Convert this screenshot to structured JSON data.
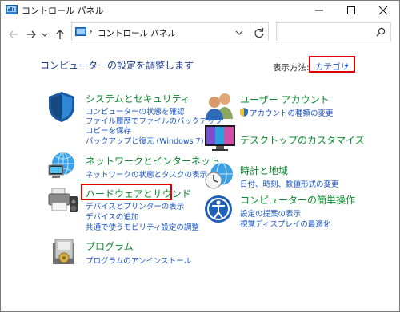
{
  "window": {
    "title": "コントロール パネル"
  },
  "address": {
    "crumb": "コントロール パネル",
    "search_placeholder": ""
  },
  "header": {
    "page_title": "コンピューターの設定を調整します",
    "view_by_label": "表示方法:",
    "view_by_value": "カテゴリ"
  },
  "categories": [
    {
      "title": "システムとセキュリティ",
      "icon": "shield-icon",
      "links": [
        "コンピューターの状態を確認",
        "ファイル履歴でファイルのバックアップ",
        "コピーを保存",
        "バックアップと復元 (Windows 7)"
      ]
    },
    {
      "title": "ネットワークとインターネット",
      "icon": "network-globe-icon",
      "links": [
        "ネットワークの状態とタスクの表示"
      ]
    },
    {
      "title": "ハードウェアとサウンド",
      "icon": "printer-speaker-icon",
      "links": [
        "デバイスとプリンターの表示",
        "デバイスの追加",
        "共通で使うモビリティ設定の調整"
      ]
    },
    {
      "title": "プログラム",
      "icon": "programs-icon",
      "links": [
        "プログラムのアンインストール"
      ]
    },
    {
      "title": "ユーザー アカウント",
      "icon": "users-icon",
      "links": [
        "アカウントの種類の変更"
      ]
    },
    {
      "title": "デスクトップのカスタマイズ",
      "icon": "monitor-icon",
      "links": []
    },
    {
      "title": "時計と地域",
      "icon": "clock-globe-icon",
      "links": [
        "日付、時刻、数値形式の変更"
      ]
    },
    {
      "title": "コンピューターの簡単操作",
      "icon": "ease-of-access-icon",
      "links": [
        "設定の提案の表示",
        "視覚ディスプレイの最適化"
      ]
    }
  ],
  "colors": {
    "accent_link": "#1a56c8",
    "category_green": "#0a8a2e",
    "highlight_red": "#e00000",
    "title_blue": "#1f3e8e"
  }
}
